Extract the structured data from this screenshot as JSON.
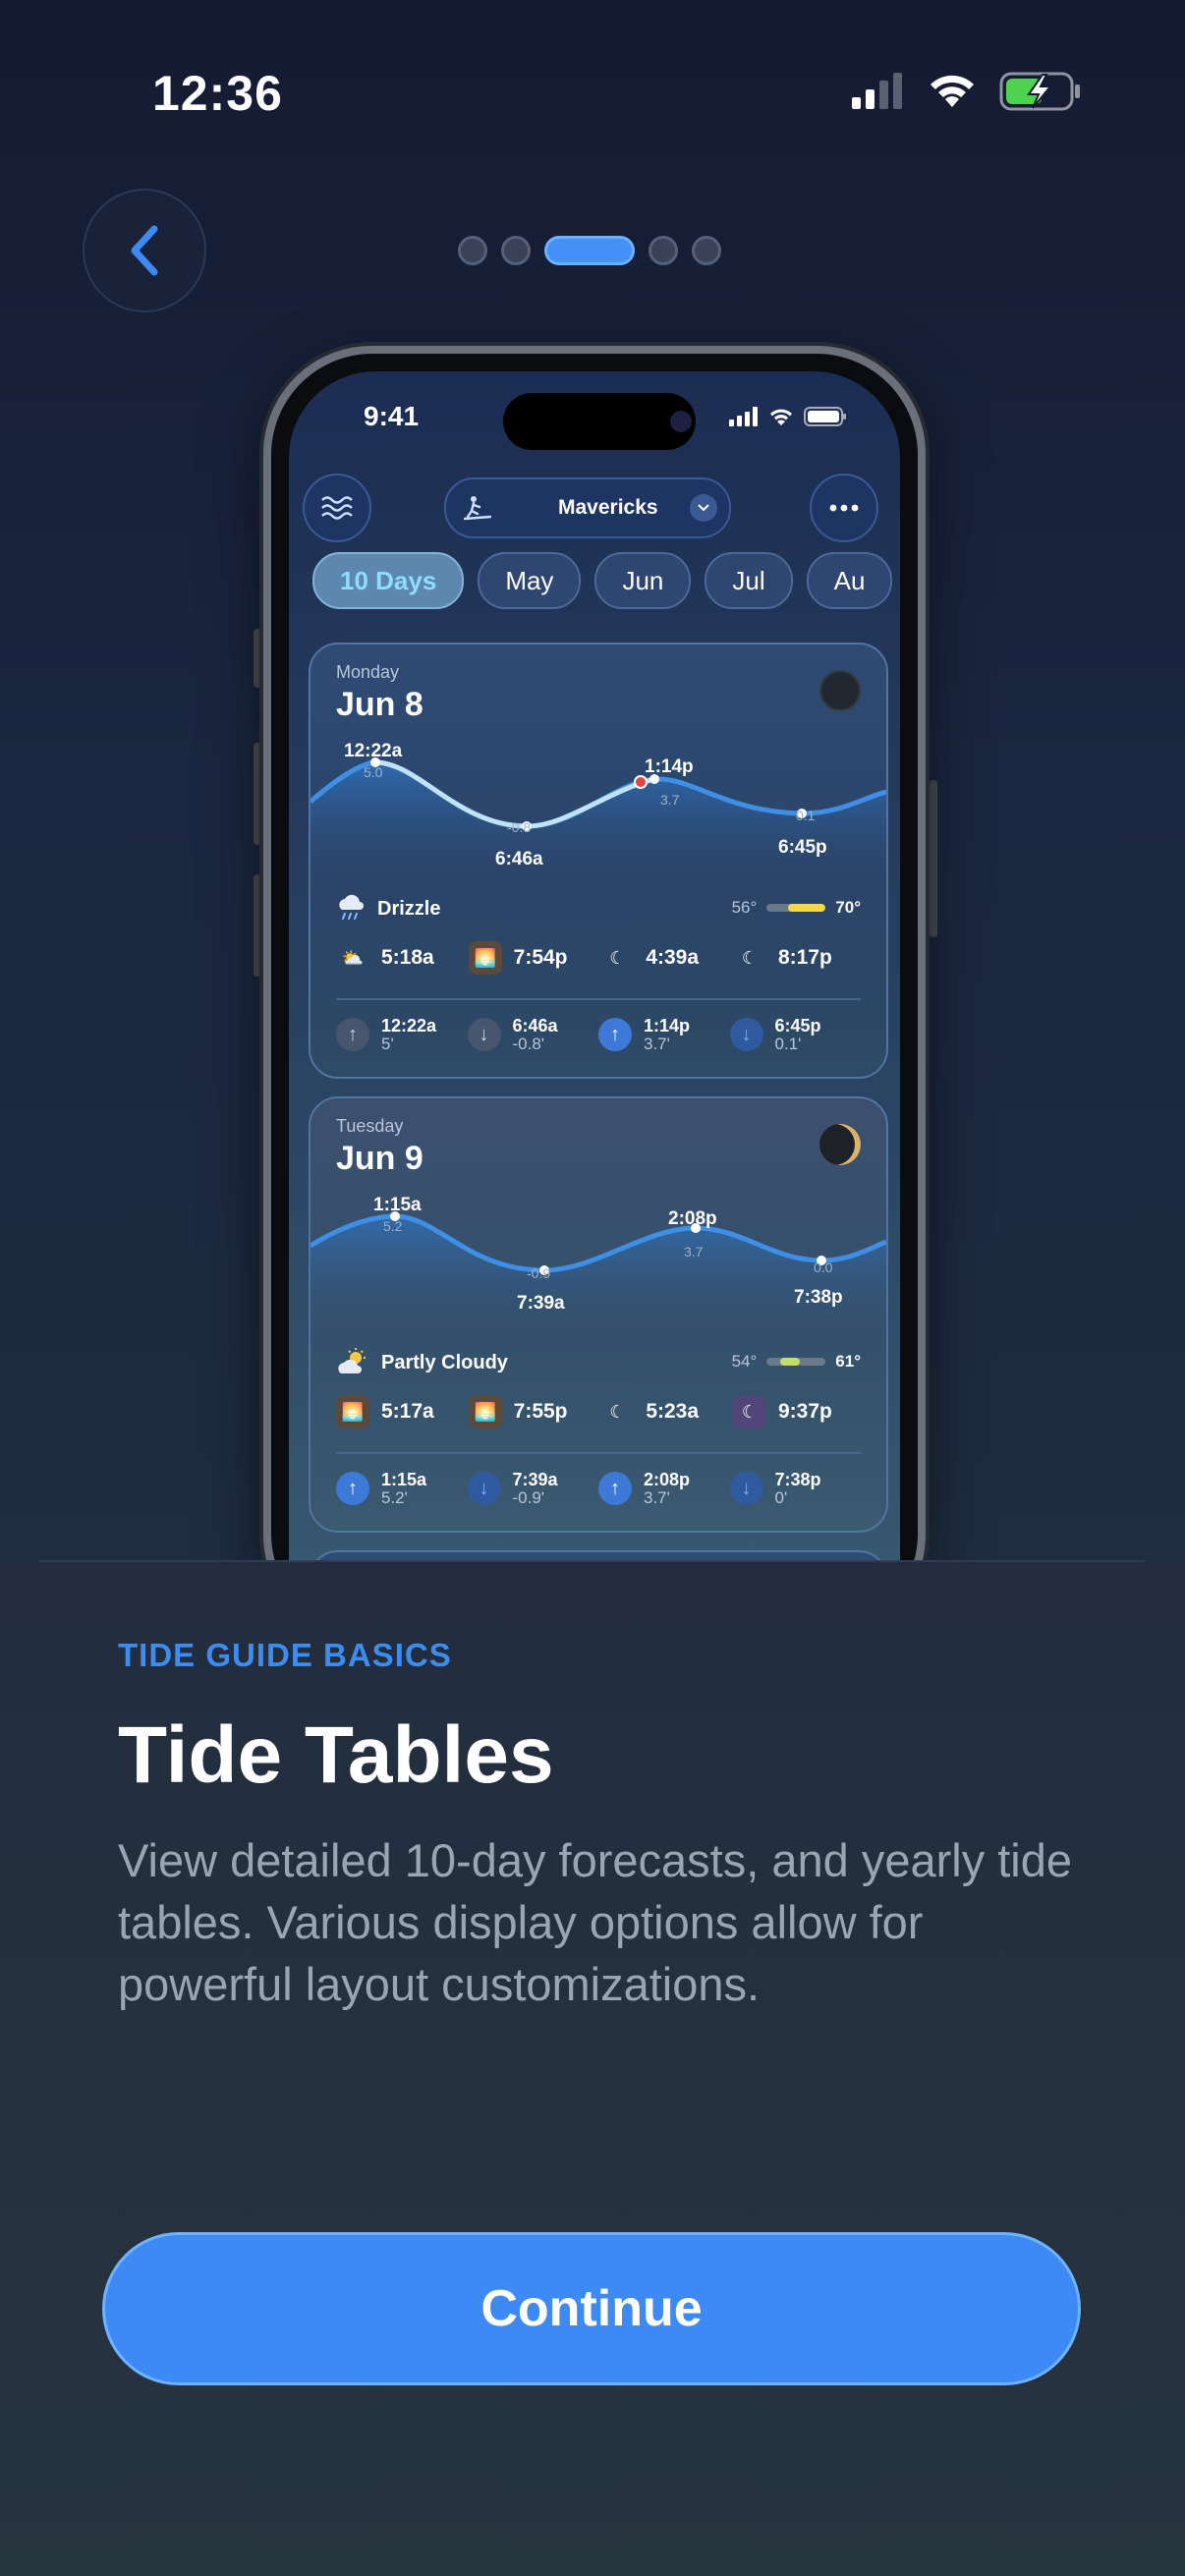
{
  "status_bar": {
    "time": "12:36"
  },
  "pager": {
    "count": 5,
    "active_index": 2
  },
  "phone": {
    "status_time": "9:41",
    "location": "Mavericks",
    "tabs": [
      "10 Days",
      "May",
      "Jun",
      "Jul",
      "Au"
    ],
    "days": [
      {
        "weekday": "Monday",
        "date": "Jun 8",
        "tide_labels": [
          {
            "time": "12:22a",
            "height": "5.0"
          },
          {
            "time": "6:46a",
            "height": "-0.8"
          },
          {
            "time": "1:14p",
            "height": "3.7"
          },
          {
            "time": "6:45p",
            "height": "0.1"
          }
        ],
        "weather": "Drizzle",
        "temp_low": "56°",
        "temp_high": "70°",
        "sun_times": [
          "5:18a",
          "7:54p",
          "4:39a",
          "8:17p"
        ],
        "tides": [
          {
            "time": "12:22a",
            "height": "5'",
            "dir": "up"
          },
          {
            "time": "6:46a",
            "height": "-0.8'",
            "dir": "down"
          },
          {
            "time": "1:14p",
            "height": "3.7'",
            "dir": "up"
          },
          {
            "time": "6:45p",
            "height": "0.1'",
            "dir": "down"
          }
        ]
      },
      {
        "weekday": "Tuesday",
        "date": "Jun 9",
        "tide_labels": [
          {
            "time": "1:15a",
            "height": "5.2"
          },
          {
            "time": "7:39a",
            "height": "-0.9"
          },
          {
            "time": "2:08p",
            "height": "3.7"
          },
          {
            "time": "7:38p",
            "height": "0.0"
          }
        ],
        "weather": "Partly Cloudy",
        "temp_low": "54°",
        "temp_high": "61°",
        "sun_times": [
          "5:17a",
          "7:55p",
          "5:23a",
          "9:37p"
        ],
        "tides": [
          {
            "time": "1:15a",
            "height": "5.2'",
            "dir": "up"
          },
          {
            "time": "7:39a",
            "height": "-0.9'",
            "dir": "down"
          },
          {
            "time": "2:08p",
            "height": "3.7'",
            "dir": "up"
          },
          {
            "time": "7:38p",
            "height": "0'",
            "dir": "down"
          }
        ]
      }
    ]
  },
  "onboarding": {
    "eyebrow": "TIDE GUIDE BASICS",
    "title": "Tide Tables",
    "description": "View detailed 10-day forecasts, and yearly tide tables. Various display options allow for powerful layout customizations.",
    "continue_label": "Continue"
  },
  "colors": {
    "accent": "#3e8af4",
    "eyebrow": "#3d8cf0",
    "background_top": "#141b31",
    "background_bottom": "#283c48"
  }
}
